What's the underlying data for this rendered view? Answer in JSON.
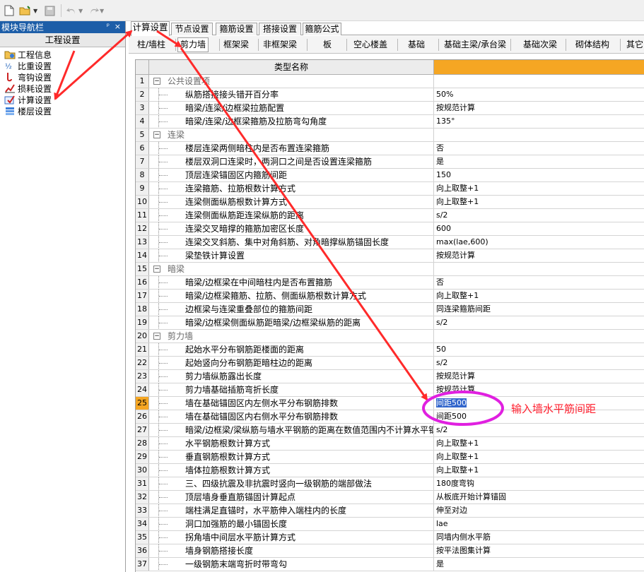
{
  "nav": {
    "title": "模块导航栏",
    "pin": "ᵖ",
    "close": "×",
    "header": "工程设置",
    "items": [
      {
        "label": "工程信息",
        "icon": "info-folder-icon"
      },
      {
        "label": "比重设置",
        "icon": "weight-icon"
      },
      {
        "label": "弯钩设置",
        "icon": "hook-icon"
      },
      {
        "label": "损耗设置",
        "icon": "loss-chart-icon"
      },
      {
        "label": "计算设置",
        "icon": "calc-settings-icon"
      },
      {
        "label": "楼层设置",
        "icon": "floor-icon"
      }
    ]
  },
  "tabs_top": [
    "计算设置",
    "节点设置",
    "箍筋设置",
    "搭接设置",
    "箍筋公式"
  ],
  "tabs_sub": [
    "柱/墙柱",
    "剪力墙",
    "框架梁",
    "非框架梁",
    "板",
    "空心楼盖",
    "基础",
    "基础主梁/承台梁",
    "基础次梁",
    "砌体结构",
    "其它"
  ],
  "grid": {
    "header": "类型名称",
    "rows": [
      {
        "n": "1",
        "name": "公共设置项",
        "value": "",
        "group": true
      },
      {
        "n": "2",
        "name": "纵筋搭接接头错开百分率",
        "value": "50%"
      },
      {
        "n": "3",
        "name": "暗梁/连梁/边框梁拉筋配置",
        "value": "按规范计算"
      },
      {
        "n": "4",
        "name": "暗梁/连梁/边框梁箍筋及拉筋弯勾角度",
        "value": "135°"
      },
      {
        "n": "5",
        "name": "连梁",
        "value": "",
        "group": true
      },
      {
        "n": "6",
        "name": "楼层连梁两侧暗柱内是否布置连梁箍筋",
        "value": "否"
      },
      {
        "n": "7",
        "name": "楼层双洞口连梁时，两洞口之间是否设置连梁箍筋",
        "value": "是"
      },
      {
        "n": "8",
        "name": "顶层连梁锚固区内箍筋间距",
        "value": "150"
      },
      {
        "n": "9",
        "name": "连梁箍筋、拉筋根数计算方式",
        "value": "向上取整+1"
      },
      {
        "n": "10",
        "name": "连梁侧面纵筋根数计算方式",
        "value": "向上取整+1"
      },
      {
        "n": "11",
        "name": "连梁侧面纵筋距连梁纵筋的距离",
        "value": "s/2"
      },
      {
        "n": "12",
        "name": "连梁交叉暗撑的箍筋加密区长度",
        "value": "600"
      },
      {
        "n": "13",
        "name": "连梁交叉斜筋、集中对角斜筋、对角暗撑纵筋锚固长度",
        "value": "max(lae,600)"
      },
      {
        "n": "14",
        "name": "梁垫铁计算设置",
        "value": "按规范计算"
      },
      {
        "n": "15",
        "name": "暗梁",
        "value": "",
        "group": true
      },
      {
        "n": "16",
        "name": "暗梁/边框梁在中间暗柱内是否布置箍筋",
        "value": "否"
      },
      {
        "n": "17",
        "name": "暗梁/边框梁箍筋、拉筋、侧面纵筋根数计算方式",
        "value": "向上取整+1"
      },
      {
        "n": "18",
        "name": "边框梁与连梁重叠部位的箍筋间距",
        "value": "同连梁箍筋间距"
      },
      {
        "n": "19",
        "name": "暗梁/边框梁侧面纵筋距暗梁/边框梁纵筋的距离",
        "value": "s/2"
      },
      {
        "n": "20",
        "name": "剪力墙",
        "value": "",
        "group": true
      },
      {
        "n": "21",
        "name": "起始水平分布钢筋距楼面的距离",
        "value": "50"
      },
      {
        "n": "22",
        "name": "起始竖向分布钢筋距暗柱边的距离",
        "value": "s/2"
      },
      {
        "n": "23",
        "name": "剪力墙纵筋露出长度",
        "value": "按规范计算"
      },
      {
        "n": "24",
        "name": "剪力墙基础插筋弯折长度",
        "value": "按规范计算"
      },
      {
        "n": "25",
        "name": "墙在基础锚固区内左侧水平分布钢筋排数",
        "value": "间距500",
        "selected": true
      },
      {
        "n": "26",
        "name": "墙在基础锚固区内右侧水平分布钢筋排数",
        "value": "间距500"
      },
      {
        "n": "27",
        "name": "暗梁/边框梁/梁纵筋与墙水平钢筋的距离在数值范围内不计算水平钢",
        "value": "s/2"
      },
      {
        "n": "28",
        "name": "水平钢筋根数计算方式",
        "value": "向上取整+1"
      },
      {
        "n": "29",
        "name": "垂直钢筋根数计算方式",
        "value": "向上取整+1"
      },
      {
        "n": "30",
        "name": "墙体拉筋根数计算方式",
        "value": "向上取整+1"
      },
      {
        "n": "31",
        "name": "三、四级抗震及非抗震时竖向一级钢筋的端部做法",
        "value": "180度弯钩"
      },
      {
        "n": "32",
        "name": "顶层墙身垂直筋锚固计算起点",
        "value": "从板底开始计算锚固"
      },
      {
        "n": "33",
        "name": "端柱满足直锚时，水平筋伸入端柱内的长度",
        "value": "伸至对边"
      },
      {
        "n": "34",
        "name": "洞口加强筋的最小锚固长度",
        "value": "lae"
      },
      {
        "n": "35",
        "name": "拐角墙中间层水平筋计算方式",
        "value": "同墙内侧水平筋"
      },
      {
        "n": "36",
        "name": "墙身钢筋搭接长度",
        "value": "按平法图集计算"
      },
      {
        "n": "37",
        "name": "一级钢筋末端弯折时带弯勾",
        "value": "是"
      }
    ]
  },
  "annotation": "输入墙水平筋间距",
  "colors": {
    "accent": "#f5a623",
    "arrow": "#ff2a2a",
    "circle": "#e020e0",
    "annotation": "#ff1e2d",
    "title_bar": "#1d5ea8"
  }
}
